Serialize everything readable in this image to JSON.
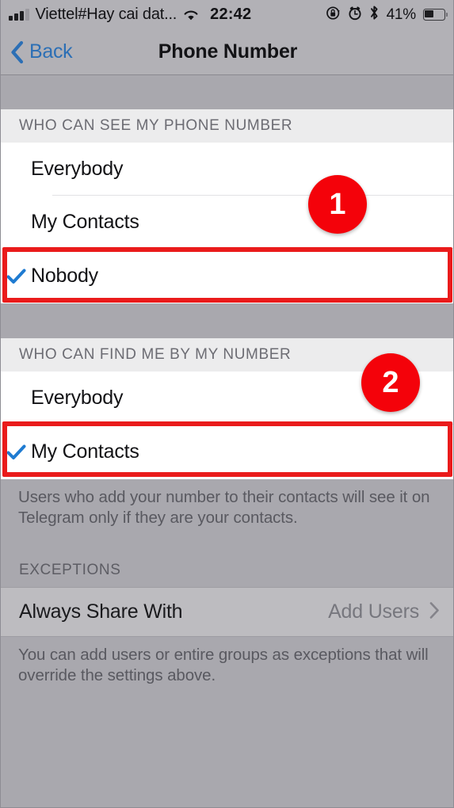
{
  "status_bar": {
    "carrier": "Viettel#Hay cai dat...",
    "signal_icon": "cellular-signal-icon",
    "wifi_icon": "wifi-icon",
    "time": "22:42",
    "rotation_lock_icon": "rotation-lock-icon",
    "alarm_icon": "alarm-clock-icon",
    "bluetooth_icon": "bluetooth-icon",
    "battery_percent": "41%",
    "battery_icon": "battery-icon"
  },
  "nav_bar": {
    "back_label": "Back",
    "back_icon": "chevron-left-icon",
    "title": "Phone Number"
  },
  "sections": [
    {
      "header": "WHO CAN SEE MY PHONE NUMBER",
      "options": [
        {
          "label": "Everybody",
          "selected": false
        },
        {
          "label": "My Contacts",
          "selected": false
        },
        {
          "label": "Nobody",
          "selected": true
        }
      ]
    },
    {
      "header": "WHO CAN FIND ME BY MY NUMBER",
      "options": [
        {
          "label": "Everybody",
          "selected": false
        },
        {
          "label": "My Contacts",
          "selected": true
        }
      ],
      "footnote": "Users who add your number to their contacts will see it on Telegram only if they are your contacts."
    },
    {
      "header": "EXCEPTIONS",
      "row": {
        "label": "Always Share With",
        "value": "Add Users",
        "disclosure_icon": "chevron-right-icon"
      },
      "footnote": "You can add users or entire groups as exceptions that will override the settings above."
    }
  ],
  "annotations": {
    "badges": [
      {
        "number": "1"
      },
      {
        "number": "2"
      }
    ],
    "highlight_color": "#ea1b1b",
    "badge_color": "#f4020a"
  },
  "colors": {
    "accent_blue": "#2c6fb5",
    "check_blue": "#1f7bd1",
    "page_background": "#a9a8ae",
    "row_background": "#ffffff",
    "section_header_background": "#ececed"
  }
}
